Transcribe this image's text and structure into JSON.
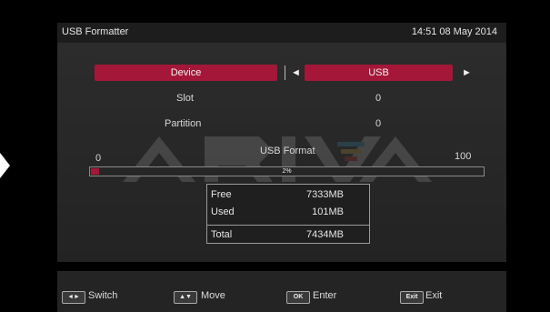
{
  "header": {
    "title": "USB Formatter",
    "clock": "14:51 08 May 2014"
  },
  "device_row": {
    "label": "Device",
    "value": "USB",
    "left_arrow": "◄",
    "right_arrow": "►"
  },
  "slot_row": {
    "label": "Slot",
    "value": "0"
  },
  "partition_row": {
    "label": "Partition",
    "value": "0"
  },
  "progress": {
    "title": "USB Format",
    "min_label": "0",
    "max_label": "100",
    "percent_text": "2%",
    "fraction": 0.02
  },
  "info": {
    "rows": [
      {
        "key": "Free",
        "value": "7333MB"
      },
      {
        "key": "Used",
        "value": "101MB"
      },
      {
        "key": "Total",
        "value": "7434MB"
      }
    ]
  },
  "footer": {
    "keys": [
      {
        "key": "◄►",
        "label": "Switch"
      },
      {
        "key": "▲▼",
        "label": "Move"
      },
      {
        "key": "OK",
        "label": "Enter"
      },
      {
        "key": "Exit",
        "label": "Exit"
      }
    ]
  },
  "colors": {
    "accent": "#a51738",
    "panel": "#2a2a2a"
  },
  "watermark": "ARIVA"
}
